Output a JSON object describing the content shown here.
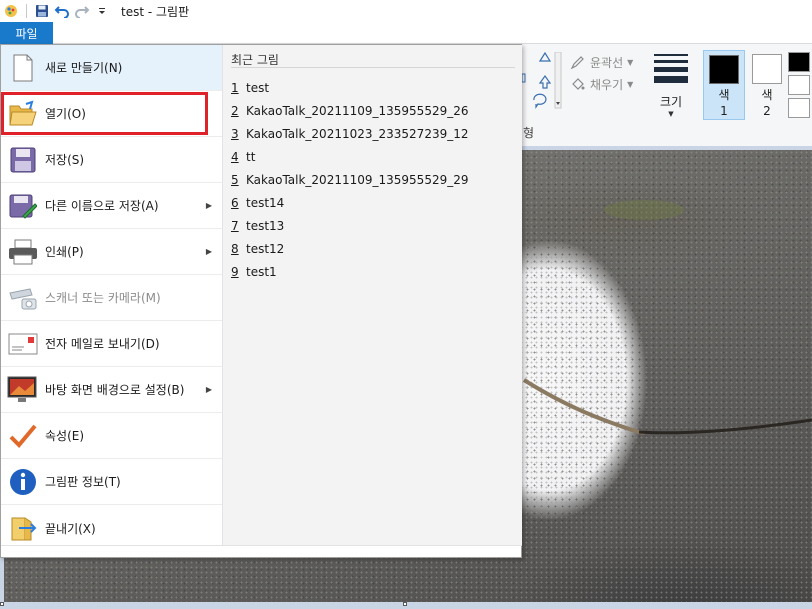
{
  "window": {
    "title": "test - 그림판"
  },
  "ribbon": {
    "file_tab": "파일",
    "outline_label": "윤곽선",
    "fill_label": "채우기",
    "group_shapes_partial": "형",
    "size_label": "크기",
    "color1_label_line1": "색",
    "color1_label_line2": "1",
    "color2_label_line1": "색",
    "color2_label_line2": "2",
    "color1_value": "#000000",
    "color2_value": "#ffffff"
  },
  "file_menu": {
    "items": [
      {
        "label": "새로 만들기(N)",
        "icon": "new-document-icon",
        "has_submenu": false,
        "enabled": true
      },
      {
        "label": "열기(O)",
        "icon": "open-folder-icon",
        "has_submenu": false,
        "enabled": true
      },
      {
        "label": "저장(S)",
        "icon": "save-disk-icon",
        "has_submenu": false,
        "enabled": true
      },
      {
        "label": "다른 이름으로 저장(A)",
        "icon": "save-as-icon",
        "has_submenu": true,
        "enabled": true
      },
      {
        "label": "인쇄(P)",
        "icon": "printer-icon",
        "has_submenu": true,
        "enabled": true
      },
      {
        "label": "스캐너 또는 카메라(M)",
        "icon": "scanner-camera-icon",
        "has_submenu": false,
        "enabled": false
      },
      {
        "label": "전자 메일로 보내기(D)",
        "icon": "email-icon",
        "has_submenu": false,
        "enabled": true
      },
      {
        "label": "바탕 화면 배경으로 설정(B)",
        "icon": "desktop-background-icon",
        "has_submenu": true,
        "enabled": true
      },
      {
        "label": "속성(E)",
        "icon": "checkmark-icon",
        "has_submenu": false,
        "enabled": true
      },
      {
        "label": "그림판 정보(T)",
        "icon": "info-icon",
        "has_submenu": false,
        "enabled": true
      },
      {
        "label": "끝내기(X)",
        "icon": "exit-icon",
        "has_submenu": false,
        "enabled": true
      }
    ],
    "recent_title": "최근 그림",
    "recent": [
      {
        "num": "1",
        "name": "test"
      },
      {
        "num": "2",
        "name": "KakaoTalk_20211109_135955529_26"
      },
      {
        "num": "3",
        "name": "KakaoTalk_20211023_233527239_12"
      },
      {
        "num": "4",
        "name": "tt"
      },
      {
        "num": "5",
        "name": "KakaoTalk_20211109_135955529_29"
      },
      {
        "num": "6",
        "name": "test14"
      },
      {
        "num": "7",
        "name": "test13"
      },
      {
        "num": "8",
        "name": "test12"
      },
      {
        "num": "9",
        "name": "test1"
      }
    ]
  },
  "colors": {
    "accent": "#1979ca",
    "highlight_border": "#e0212a",
    "hover": "#e5f1fb"
  }
}
